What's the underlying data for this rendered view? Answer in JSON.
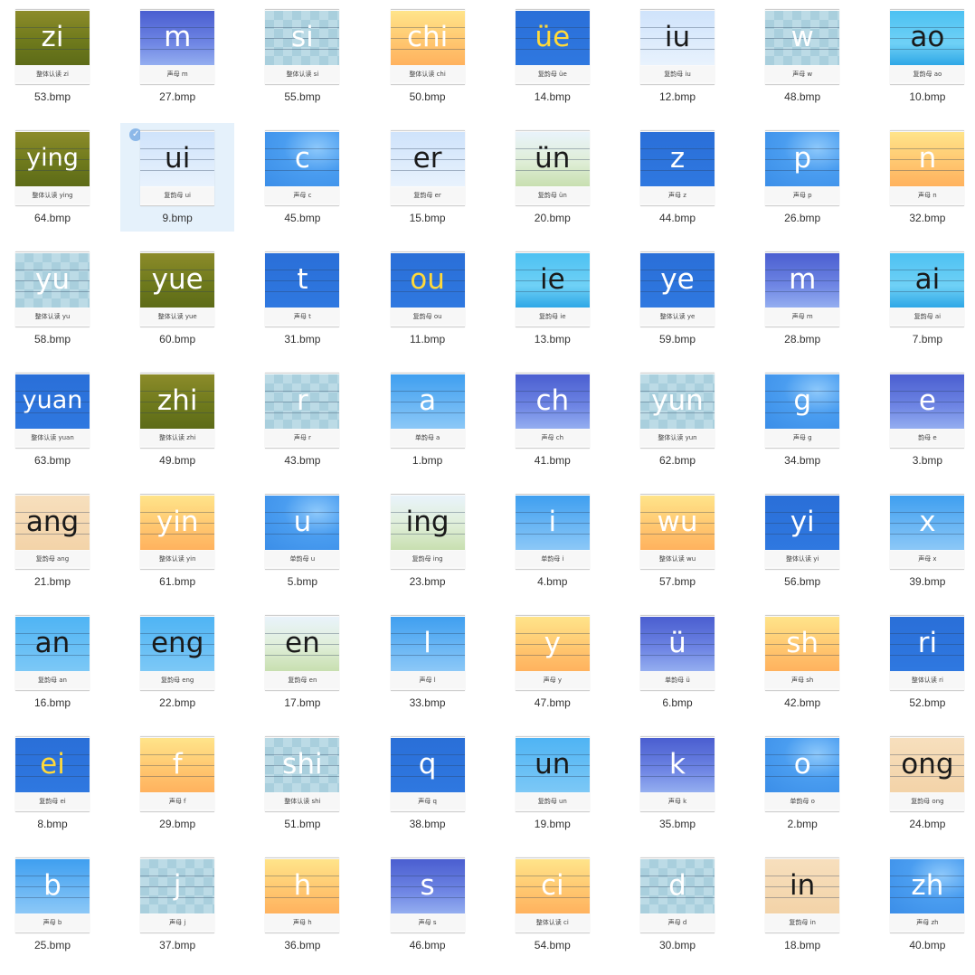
{
  "files": [
    {
      "name": "53.bmp",
      "label": "zi",
      "caption": "整体认读 zi",
      "bg": "grass",
      "color": "white"
    },
    {
      "name": "27.bmp",
      "label": "m",
      "caption": "声母 m",
      "bg": "purple",
      "color": "white"
    },
    {
      "name": "55.bmp",
      "label": "si",
      "caption": "整体认读 si",
      "bg": "check",
      "color": "white"
    },
    {
      "name": "50.bmp",
      "label": "chi",
      "caption": "整体认读 chi",
      "bg": "peach",
      "color": "white"
    },
    {
      "name": "14.bmp",
      "label": "üe",
      "caption": "复韵母 üe",
      "bg": "royal",
      "color": "yellow"
    },
    {
      "name": "12.bmp",
      "label": "iu",
      "caption": "复韵母 iu",
      "bg": "sky",
      "color": "dark"
    },
    {
      "name": "48.bmp",
      "label": "w",
      "caption": "声母 w",
      "bg": "check",
      "color": "white"
    },
    {
      "name": "10.bmp",
      "label": "ao",
      "caption": "复韵母 ao",
      "bg": "sea",
      "color": "dark"
    },
    {
      "name": "64.bmp",
      "label": "ying",
      "caption": "整体认读 ying",
      "bg": "grass",
      "color": "white"
    },
    {
      "name": "9.bmp",
      "label": "ui",
      "caption": "复韵母 ui",
      "bg": "sky",
      "color": "dark",
      "selected": true
    },
    {
      "name": "45.bmp",
      "label": "c",
      "caption": "声母 c",
      "bg": "swirl",
      "color": "white"
    },
    {
      "name": "15.bmp",
      "label": "er",
      "caption": "复韵母 er",
      "bg": "sky",
      "color": "dark"
    },
    {
      "name": "20.bmp",
      "label": "ün",
      "caption": "复韵母 ün",
      "bg": "meadow",
      "color": "dark"
    },
    {
      "name": "44.bmp",
      "label": "z",
      "caption": "声母 z",
      "bg": "royal",
      "color": "white"
    },
    {
      "name": "26.bmp",
      "label": "p",
      "caption": "声母 p",
      "bg": "swirl",
      "color": "white"
    },
    {
      "name": "32.bmp",
      "label": "n",
      "caption": "声母 n",
      "bg": "peach",
      "color": "white"
    },
    {
      "name": "58.bmp",
      "label": "yu",
      "caption": "整体认读 yu",
      "bg": "check",
      "color": "white"
    },
    {
      "name": "60.bmp",
      "label": "yue",
      "caption": "整体认读 yue",
      "bg": "grass",
      "color": "white"
    },
    {
      "name": "31.bmp",
      "label": "t",
      "caption": "声母 t",
      "bg": "royal",
      "color": "white"
    },
    {
      "name": "11.bmp",
      "label": "ou",
      "caption": "复韵母 ou",
      "bg": "royal",
      "color": "yellow"
    },
    {
      "name": "13.bmp",
      "label": "ie",
      "caption": "复韵母 ie",
      "bg": "sea",
      "color": "dark"
    },
    {
      "name": "59.bmp",
      "label": "ye",
      "caption": "整体认读 ye",
      "bg": "royal",
      "color": "white"
    },
    {
      "name": "28.bmp",
      "label": "m",
      "caption": "声母 m",
      "bg": "purple",
      "color": "white"
    },
    {
      "name": "7.bmp",
      "label": "ai",
      "caption": "复韵母 ai",
      "bg": "sea",
      "color": "dark"
    },
    {
      "name": "63.bmp",
      "label": "yuan",
      "caption": "整体认读 yuan",
      "bg": "royal",
      "color": "white"
    },
    {
      "name": "49.bmp",
      "label": "zhi",
      "caption": "整体认读 zhi",
      "bg": "grass",
      "color": "white"
    },
    {
      "name": "43.bmp",
      "label": "r",
      "caption": "声母 r",
      "bg": "check",
      "color": "white"
    },
    {
      "name": "1.bmp",
      "label": "a",
      "caption": "单韵母 a",
      "bg": "lightblue",
      "color": "white"
    },
    {
      "name": "41.bmp",
      "label": "ch",
      "caption": "声母 ch",
      "bg": "purple",
      "color": "white"
    },
    {
      "name": "62.bmp",
      "label": "yun",
      "caption": "整体认读 yun",
      "bg": "check",
      "color": "white"
    },
    {
      "name": "34.bmp",
      "label": "g",
      "caption": "声母 g",
      "bg": "swirl",
      "color": "white"
    },
    {
      "name": "3.bmp",
      "label": "e",
      "caption": "韵母 e",
      "bg": "purple",
      "color": "white"
    },
    {
      "name": "21.bmp",
      "label": "ang",
      "caption": "复韵母 ang",
      "bg": "tan",
      "color": "dark"
    },
    {
      "name": "61.bmp",
      "label": "yin",
      "caption": "整体认读 yin",
      "bg": "peach",
      "color": "white"
    },
    {
      "name": "5.bmp",
      "label": "u",
      "caption": "单韵母 u",
      "bg": "swirl",
      "color": "white"
    },
    {
      "name": "23.bmp",
      "label": "ing",
      "caption": "复韵母 ing",
      "bg": "meadow",
      "color": "dark"
    },
    {
      "name": "4.bmp",
      "label": "i",
      "caption": "单韵母 i",
      "bg": "lightblue",
      "color": "white"
    },
    {
      "name": "57.bmp",
      "label": "wu",
      "caption": "整体认读 wu",
      "bg": "peach",
      "color": "white"
    },
    {
      "name": "56.bmp",
      "label": "yi",
      "caption": "整体认读 yi",
      "bg": "royal",
      "color": "white"
    },
    {
      "name": "39.bmp",
      "label": "x",
      "caption": "声母 x",
      "bg": "lightblue",
      "color": "white"
    },
    {
      "name": "16.bmp",
      "label": "an",
      "caption": "复韵母 an",
      "bg": "cyan",
      "color": "dark"
    },
    {
      "name": "22.bmp",
      "label": "eng",
      "caption": "复韵母 eng",
      "bg": "cyan",
      "color": "dark"
    },
    {
      "name": "17.bmp",
      "label": "en",
      "caption": "复韵母 en",
      "bg": "meadow",
      "color": "dark"
    },
    {
      "name": "33.bmp",
      "label": "l",
      "caption": "声母 l",
      "bg": "lightblue",
      "color": "white"
    },
    {
      "name": "47.bmp",
      "label": "y",
      "caption": "声母 y",
      "bg": "peach",
      "color": "white"
    },
    {
      "name": "6.bmp",
      "label": "ü",
      "caption": "单韵母 ü",
      "bg": "purple",
      "color": "white"
    },
    {
      "name": "42.bmp",
      "label": "sh",
      "caption": "声母 sh",
      "bg": "peach",
      "color": "white"
    },
    {
      "name": "52.bmp",
      "label": "ri",
      "caption": "整体认读 ri",
      "bg": "royal",
      "color": "white"
    },
    {
      "name": "8.bmp",
      "label": "ei",
      "caption": "复韵母 ei",
      "bg": "royal",
      "color": "yellow"
    },
    {
      "name": "29.bmp",
      "label": "f",
      "caption": "声母 f",
      "bg": "peach",
      "color": "white"
    },
    {
      "name": "51.bmp",
      "label": "shi",
      "caption": "整体认读 shi",
      "bg": "check",
      "color": "white"
    },
    {
      "name": "38.bmp",
      "label": "q",
      "caption": "声母 q",
      "bg": "royal",
      "color": "white"
    },
    {
      "name": "19.bmp",
      "label": "un",
      "caption": "复韵母 un",
      "bg": "cyan",
      "color": "dark"
    },
    {
      "name": "35.bmp",
      "label": "k",
      "caption": "声母 k",
      "bg": "purple",
      "color": "white"
    },
    {
      "name": "2.bmp",
      "label": "o",
      "caption": "单韵母 o",
      "bg": "swirl",
      "color": "white"
    },
    {
      "name": "24.bmp",
      "label": "ong",
      "caption": "复韵母 ong",
      "bg": "tan",
      "color": "dark"
    },
    {
      "name": "25.bmp",
      "label": "b",
      "caption": "声母 b",
      "bg": "lightblue",
      "color": "white"
    },
    {
      "name": "37.bmp",
      "label": "j",
      "caption": "声母 j",
      "bg": "check",
      "color": "white"
    },
    {
      "name": "36.bmp",
      "label": "h",
      "caption": "声母 h",
      "bg": "peach",
      "color": "white"
    },
    {
      "name": "46.bmp",
      "label": "s",
      "caption": "声母 s",
      "bg": "purple",
      "color": "white"
    },
    {
      "name": "54.bmp",
      "label": "ci",
      "caption": "整体认读 ci",
      "bg": "peach",
      "color": "white"
    },
    {
      "name": "30.bmp",
      "label": "d",
      "caption": "声母 d",
      "bg": "check",
      "color": "white"
    },
    {
      "name": "18.bmp",
      "label": "in",
      "caption": "复韵母 in",
      "bg": "tan",
      "color": "dark"
    },
    {
      "name": "40.bmp",
      "label": "zh",
      "caption": "声母 zh",
      "bg": "swirl",
      "color": "white"
    }
  ],
  "selection_icon": "checkmark-icon",
  "colors": {
    "selected_bg": "#e5f1fb",
    "check": "#8cb8e8"
  }
}
